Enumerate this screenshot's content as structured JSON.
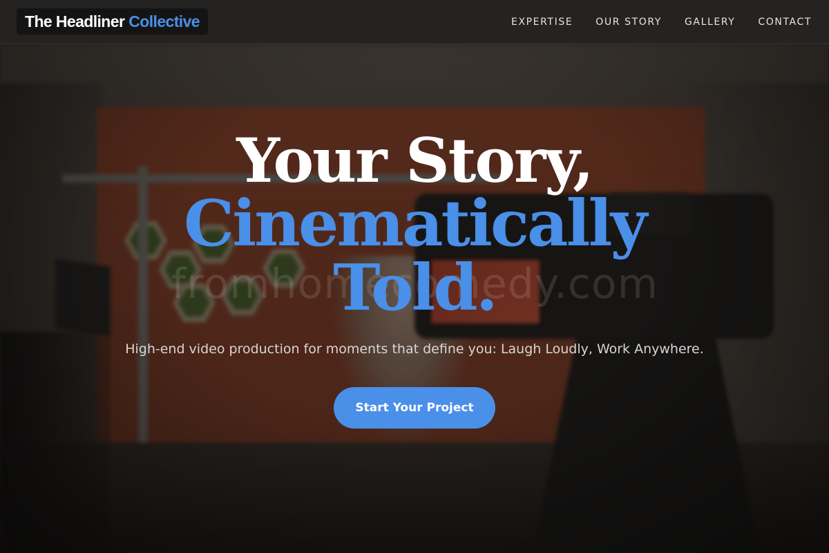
{
  "brand": {
    "name": "The Headliner",
    "accent": "Collective"
  },
  "nav": {
    "items": [
      {
        "label": "EXPERTISE"
      },
      {
        "label": "OUR STORY"
      },
      {
        "label": "GALLERY"
      },
      {
        "label": "CONTACT"
      }
    ]
  },
  "hero": {
    "headline_line1": "Your Story,",
    "headline_line2": "Cinematically",
    "headline_line3": "Told.",
    "subtitle": "High-end video production for moments that define you: Laugh Loudly, Work Anywhere.",
    "cta_label": "Start Your Project",
    "watermark": "fromhomecomedy.com"
  },
  "colors": {
    "accent": "#4a8fe8",
    "nav_background": "#252322",
    "headline_white": "#ffffff"
  }
}
